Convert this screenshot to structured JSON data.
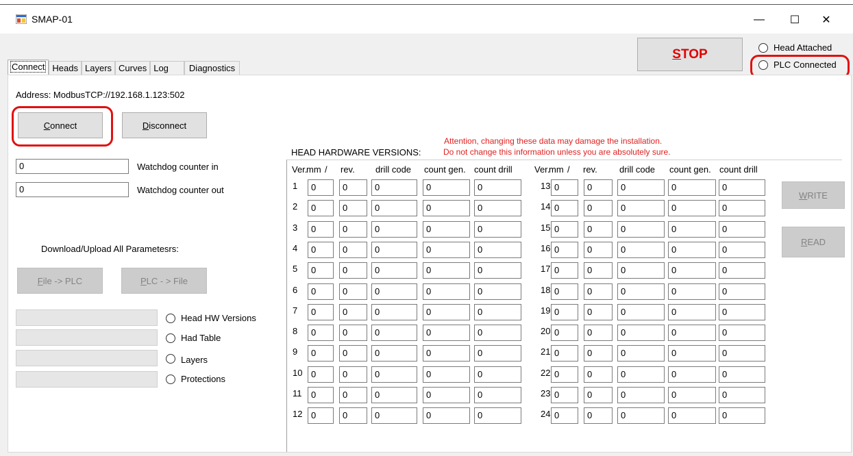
{
  "window": {
    "title": "SMAP-01"
  },
  "window_controls": {
    "minimize": "—",
    "maximize": "☐",
    "close": "✕"
  },
  "stop": {
    "prefix": "S",
    "rest": "TOP"
  },
  "status": {
    "head_attached": "Head Attached",
    "plc_connected": "PLC Connected"
  },
  "tabs": [
    "Connect",
    "Heads",
    "Layers",
    "Curves",
    "Log",
    "Diagnostics"
  ],
  "connect": {
    "address": "Address: ModbusTCP://192.168.1.123:502",
    "connect_btn": {
      "u": "C",
      "rest": "onnect"
    },
    "disconnect_btn": {
      "u": "D",
      "rest": "isconnect"
    },
    "watchdog_in_value": "0",
    "watchdog_in_label": "Watchdog counter in",
    "watchdog_out_value": "0",
    "watchdog_out_label": "Watchdog counter out",
    "download_label": "Download/Upload All Parametesrs:",
    "file_plc": {
      "u": "F",
      "rest": "ile -> PLC"
    },
    "plc_file": {
      "u": "P",
      "rest": "LC - > File"
    },
    "options": [
      "Head HW Versions",
      "Had Table",
      "Layers",
      "Protections"
    ]
  },
  "hardware": {
    "title": "HEAD HARDWARE VERSIONS:",
    "warning1": "Attention, changing these data may damage the installation.",
    "warning2": "Do not change this information unless you are absolutely sure.",
    "headers": [
      "Ver.",
      "mm",
      "/",
      "rev.",
      "drill code",
      "count gen.",
      "count drill"
    ],
    "rows_left": [
      {
        "n": "1",
        "v": [
          "0",
          "0",
          "0",
          "0",
          "0"
        ]
      },
      {
        "n": "2",
        "v": [
          "0",
          "0",
          "0",
          "0",
          "0"
        ]
      },
      {
        "n": "3",
        "v": [
          "0",
          "0",
          "0",
          "0",
          "0"
        ]
      },
      {
        "n": "4",
        "v": [
          "0",
          "0",
          "0",
          "0",
          "0"
        ]
      },
      {
        "n": "5",
        "v": [
          "0",
          "0",
          "0",
          "0",
          "0"
        ]
      },
      {
        "n": "6",
        "v": [
          "0",
          "0",
          "0",
          "0",
          "0"
        ]
      },
      {
        "n": "7",
        "v": [
          "0",
          "0",
          "0",
          "0",
          "0"
        ]
      },
      {
        "n": "8",
        "v": [
          "0",
          "0",
          "0",
          "0",
          "0"
        ]
      },
      {
        "n": "9",
        "v": [
          "0",
          "0",
          "0",
          "0",
          "0"
        ]
      },
      {
        "n": "10",
        "v": [
          "0",
          "0",
          "0",
          "0",
          "0"
        ]
      },
      {
        "n": "11",
        "v": [
          "0",
          "0",
          "0",
          "0",
          "0"
        ]
      },
      {
        "n": "12",
        "v": [
          "0",
          "0",
          "0",
          "0",
          "0"
        ]
      }
    ],
    "rows_right": [
      {
        "n": "13",
        "v": [
          "0",
          "0",
          "0",
          "0",
          "0"
        ]
      },
      {
        "n": "14",
        "v": [
          "0",
          "0",
          "0",
          "0",
          "0"
        ]
      },
      {
        "n": "15",
        "v": [
          "0",
          "0",
          "0",
          "0",
          "0"
        ]
      },
      {
        "n": "16",
        "v": [
          "0",
          "0",
          "0",
          "0",
          "0"
        ]
      },
      {
        "n": "17",
        "v": [
          "0",
          "0",
          "0",
          "0",
          "0"
        ]
      },
      {
        "n": "18",
        "v": [
          "0",
          "0",
          "0",
          "0",
          "0"
        ]
      },
      {
        "n": "19",
        "v": [
          "0",
          "0",
          "0",
          "0",
          "0"
        ]
      },
      {
        "n": "20",
        "v": [
          "0",
          "0",
          "0",
          "0",
          "0"
        ]
      },
      {
        "n": "21",
        "v": [
          "0",
          "0",
          "0",
          "0",
          "0"
        ]
      },
      {
        "n": "22",
        "v": [
          "0",
          "0",
          "0",
          "0",
          "0"
        ]
      },
      {
        "n": "23",
        "v": [
          "0",
          "0",
          "0",
          "0",
          "0"
        ]
      },
      {
        "n": "24",
        "v": [
          "0",
          "0",
          "0",
          "0",
          "0"
        ]
      }
    ],
    "write_btn": {
      "u": "W",
      "rest": "RITE"
    },
    "read_btn": {
      "u": "R",
      "rest": "EAD"
    }
  },
  "colors": {
    "annotation_red": "#e01010",
    "warning_red": "#e02020",
    "stop_red": "#e00000"
  }
}
